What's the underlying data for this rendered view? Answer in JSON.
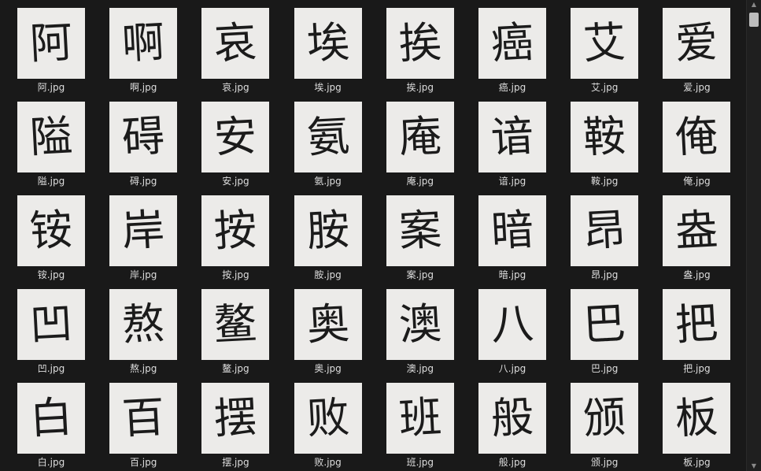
{
  "files": [
    {
      "char": "阿",
      "name": "阿.jpg"
    },
    {
      "char": "啊",
      "name": "啊.jpg"
    },
    {
      "char": "哀",
      "name": "哀.jpg"
    },
    {
      "char": "埃",
      "name": "埃.jpg"
    },
    {
      "char": "挨",
      "name": "挨.jpg"
    },
    {
      "char": "癌",
      "name": "癌.jpg"
    },
    {
      "char": "艾",
      "name": "艾.jpg"
    },
    {
      "char": "爱",
      "name": "爱.jpg"
    },
    {
      "char": "隘",
      "name": "隘.jpg"
    },
    {
      "char": "碍",
      "name": "碍.jpg"
    },
    {
      "char": "安",
      "name": "安.jpg"
    },
    {
      "char": "氨",
      "name": "氨.jpg"
    },
    {
      "char": "庵",
      "name": "庵.jpg"
    },
    {
      "char": "谙",
      "name": "谙.jpg"
    },
    {
      "char": "鞍",
      "name": "鞍.jpg"
    },
    {
      "char": "俺",
      "name": "俺.jpg"
    },
    {
      "char": "铵",
      "name": "铵.jpg"
    },
    {
      "char": "岸",
      "name": "岸.jpg"
    },
    {
      "char": "按",
      "name": "按.jpg"
    },
    {
      "char": "胺",
      "name": "胺.jpg"
    },
    {
      "char": "案",
      "name": "案.jpg"
    },
    {
      "char": "暗",
      "name": "暗.jpg"
    },
    {
      "char": "昂",
      "name": "昂.jpg"
    },
    {
      "char": "盎",
      "name": "盎.jpg"
    },
    {
      "char": "凹",
      "name": "凹.jpg"
    },
    {
      "char": "熬",
      "name": "熬.jpg"
    },
    {
      "char": "鳌",
      "name": "鳌.jpg"
    },
    {
      "char": "奥",
      "name": "奥.jpg"
    },
    {
      "char": "澳",
      "name": "澳.jpg"
    },
    {
      "char": "八",
      "name": "八.jpg"
    },
    {
      "char": "巴",
      "name": "巴.jpg"
    },
    {
      "char": "把",
      "name": "把.jpg"
    },
    {
      "char": "白",
      "name": "白.jpg"
    },
    {
      "char": "百",
      "name": "百.jpg"
    },
    {
      "char": "摆",
      "name": "摆.jpg"
    },
    {
      "char": "败",
      "name": "败.jpg"
    },
    {
      "char": "班",
      "name": "班.jpg"
    },
    {
      "char": "般",
      "name": "般.jpg"
    },
    {
      "char": "颁",
      "name": "颁.jpg"
    },
    {
      "char": "板",
      "name": "板.jpg"
    }
  ],
  "scrollbar": {
    "up_icon": "▲",
    "down_icon": "▼"
  }
}
